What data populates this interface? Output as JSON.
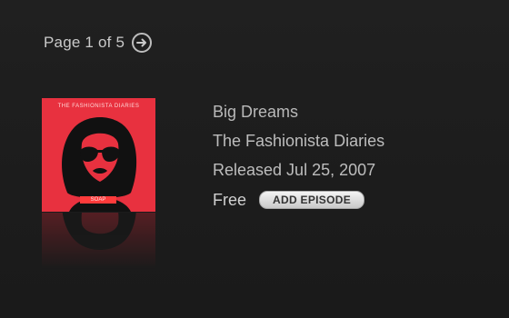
{
  "pager": {
    "label": "Page 1 of 5",
    "next_icon": "circle-arrow-right-icon"
  },
  "podcast": {
    "artwork_title": "THE FASHIONISTA DIARIES",
    "artwork_badge": "SOAP",
    "artwork_color": "#e8313f",
    "episode_title": "Big Dreams",
    "show_name": "The Fashionista Diaries",
    "released": "Released Jul 25, 2007",
    "price": "Free",
    "add_button_label": "ADD EPISODE"
  }
}
